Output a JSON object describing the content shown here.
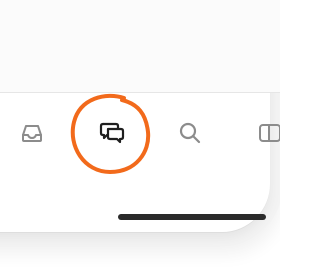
{
  "tabbar": {
    "items": [
      {
        "icon": "inbox-icon",
        "selected": false
      },
      {
        "icon": "messages-icon",
        "selected": true
      },
      {
        "icon": "search-icon",
        "selected": false
      },
      {
        "icon": "sidebar-icon",
        "selected": false
      }
    ]
  },
  "annotation": {
    "color": "#f26a1b",
    "target": "messages-tab"
  },
  "colors": {
    "icon": "#8c8c8c",
    "icon_selected": "#1f1f1f",
    "annotation": "#f26a1b",
    "home_indicator": "#2a2a2a"
  }
}
